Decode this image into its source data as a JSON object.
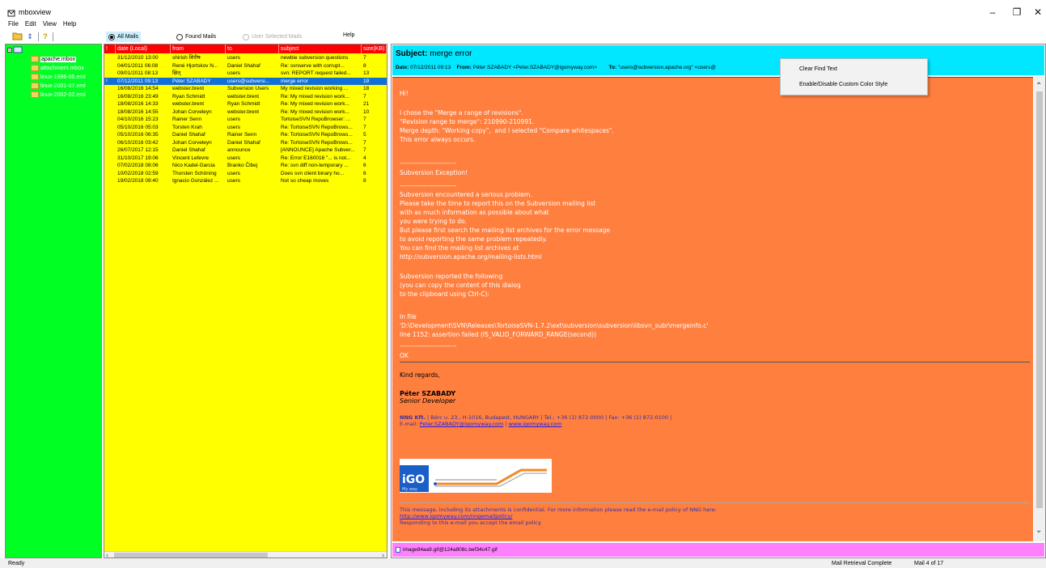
{
  "window": {
    "title": "mboxview"
  },
  "menu": [
    "File",
    "Edit",
    "View",
    "Help"
  ],
  "toolbar": {
    "radios": [
      {
        "label": "All Mails",
        "checked": true,
        "enabled": true
      },
      {
        "label": "Found Mails",
        "checked": false,
        "enabled": true
      },
      {
        "label": "User Selected Mails",
        "checked": false,
        "enabled": false
      }
    ],
    "help_label": "Help"
  },
  "tree": {
    "items": [
      "apache.mbox",
      "attachment.mbox",
      "linux-1996-05.eml",
      "linux-2001-07.eml",
      "linux-2002-02.eml"
    ],
    "selected": "apache.mbox"
  },
  "list": {
    "columns": [
      "!",
      "date (Local)",
      "from",
      "to",
      "subject",
      "size(KB)"
    ],
    "rows": [
      [
        "",
        "31/12/2010 13:00",
        "shirish शिरीष",
        "users",
        "newbie subversion questions",
        "7"
      ],
      [
        "",
        "04/01/2011 06:08",
        "René Hjortskov N...",
        "Daniel Shahaf",
        "Re: svnserve with corrupt...",
        "8"
      ],
      [
        "",
        "09/01/2011 08:13",
        "क्षित्",
        "users",
        "svn: REPORT request failed...",
        "13"
      ],
      [
        "!",
        "07/12/2011 09:13",
        "Péter SZABADY",
        "users@subversi...",
        "merge error",
        "19"
      ],
      [
        "",
        "16/08/2016 14:54",
        "webster.brent",
        "Subversion Users",
        "My mixed revision working ...",
        "18"
      ],
      [
        "",
        "16/08/2016 23:49",
        "Ryan Schmidt",
        "webster.brent",
        "Re: My mixed revision work...",
        "7"
      ],
      [
        "",
        "18/08/2016 14:33",
        "webster.brent",
        "Ryan Schmidt",
        "Re: My mixed revision work...",
        "21"
      ],
      [
        "",
        "18/08/2016 14:55",
        "Johan Corveleyn",
        "webster.brent",
        "Re: My mixed revision work...",
        "10"
      ],
      [
        "",
        "04/10/2016 15:23",
        "Rainer Senn",
        "users",
        "TortoiseSVN RepoBrowser: ...",
        "7"
      ],
      [
        "",
        "05/10/2016 05:03",
        "Torsten Krah",
        "users",
        "Re: TortoiseSVN RepoBrows...",
        "7"
      ],
      [
        "",
        "05/10/2016 06:35",
        "Daniel Shahaf",
        "Rainer Senn",
        "Re: TortoiseSVN RepoBrows...",
        "5"
      ],
      [
        "",
        "06/10/2016 03:42",
        "Johan Corveleyn",
        "Daniel Shahaf",
        "Re: TortoiseSVN RepoBrows...",
        "7"
      ],
      [
        "",
        "26/07/2017 12:15",
        "Daniel Shahaf",
        "announce",
        "[ANNOUNCE] Apache Subver...",
        "7"
      ],
      [
        "",
        "31/10/2017 19:06",
        "Vincent Lefevre",
        "users",
        "Re: Error E160016 \"... is not...",
        "4"
      ],
      [
        "",
        "07/02/2018 08:06",
        "Nico Kadel-Garcia",
        "Branko Čibej",
        "Re: svn diff non-temporary ...",
        "6"
      ],
      [
        "",
        "10/02/2018 02:59",
        "Thorsten Schöning",
        "users",
        "Does svn client binary ho...",
        "6"
      ],
      [
        "",
        "19/02/2018 08:40",
        "Ignacio González ...",
        "users",
        "Not so cheap moves",
        "8"
      ]
    ],
    "selected_index": 3
  },
  "mail": {
    "subject_label": "Subject:",
    "subject": "merge error",
    "date_label": "Date:",
    "date": "07/12/2011 09:13",
    "from_label": "From:",
    "from": "Péter SZABADY <Peter.SZABADY@igomyway.com>",
    "to_label": "To:",
    "to": "\"users@subversion.apache.org\" <users@",
    "body": {
      "greeting": "Hi!",
      "intro": "I chose the \"Merge a range of revisions\".\n\"Revision range to merge\": 210990-210991.\nMerge depth: \"Working copy\",  and I selected \"Compare whitespaces\".\nThis error always occurs.",
      "dashes1": "--------------------------",
      "exception_title": "Subversion Exception!",
      "exception_text": "--------------------------\nSubversion encountered a serious problem.\nPlease take the time to report this on the Subversion mailing list\nwith as much information as possible about what\nyou were trying to do.\nBut please first search the mailing list archives for the error message\nto avoid reporting the same problem repeatedly.\nYou can find the mailing list archives at\nhttp://subversion.apache.org/mailing-lists.html",
      "reported": "Subversion reported the following\n(you can copy the content of this dialog\nto the clipboard using Ctrl-C):",
      "infile": "In file\n'D:\\Development\\SVN\\Releases\\TortoiseSVN-1.7.2\\ext\\subversion\\subversion\\libsvn_subr\\mergeinfo.c'\nline 1152: assertion failed (IS_VALID_FORWARD_RANGE(second))",
      "dashes2": "--------------------------",
      "ok": "OK",
      "regards": "Kind regards,",
      "sig_name": "Péter SZABADY",
      "sig_role": "Senior Developer",
      "sig_company": "NNG Kft.",
      "sig_address": " | Bérc u. 23., H-1016, Budapest, HUNGARY | Tel.: +36 (1) 872-0000 | Fax: +36 (1) 872-0100 |",
      "sig_email_label": "E-mail: ",
      "sig_email": "Peter.SZABADY@igomyway.com",
      "sig_sep": " | ",
      "sig_web": "www.igomyway.com",
      "logo_text": "iGO",
      "logo_tagline": "My way",
      "disclaimer1": "This message, including its attachments is confidential. For more information please read the e-mail policy of NNG here:",
      "disclaimer_link": "http://www.igomyway.com/nngemailpolicy/",
      "disclaimer2": "Responding to this e-mail you accept the email policy."
    },
    "attachment": "image84aa9.gif@124a808c.bef34c47.gif"
  },
  "context_menu": [
    "Clear Find Text",
    "Enable/Disable Custom Color Style"
  ],
  "status": {
    "ready": "Ready",
    "retrieval": "Mail Retrieval Complete",
    "count": "Mail 4 of 17"
  },
  "colors": {
    "tree_bg": "#00ff22",
    "list_bg": "#ffff00",
    "list_header_bg": "#ff0000",
    "selected_row": "#1070d8",
    "mail_header_bg": "#00e7ff",
    "mail_body_bg": "#ff7f3f",
    "attachment_bar_bg": "#ff80ff"
  }
}
